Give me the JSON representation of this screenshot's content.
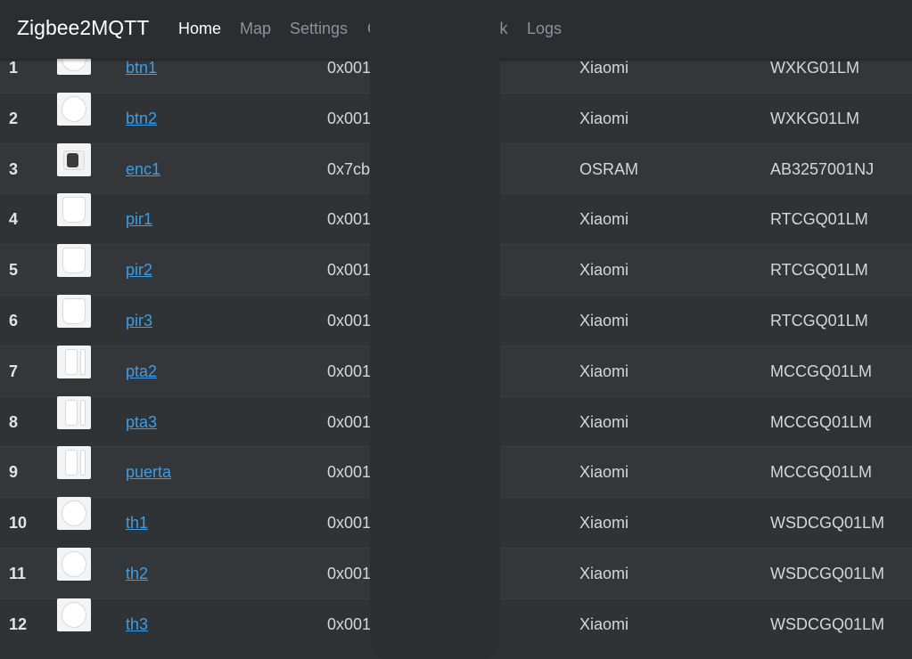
{
  "navbar": {
    "brand": "Zigbee2MQTT",
    "items": [
      {
        "label": "Home",
        "active": true
      },
      {
        "label": "Map",
        "active": false
      },
      {
        "label": "Settings",
        "active": false
      },
      {
        "label": "G",
        "active": false
      },
      {
        "label": "'ink",
        "active": false
      },
      {
        "label": "Logs",
        "active": false
      }
    ]
  },
  "devices": [
    {
      "num": "1",
      "name": "btn1",
      "addr": "0x001",
      "vendor": "Xiaomi",
      "model": "WXKG01LM",
      "icon": "round-button"
    },
    {
      "num": "2",
      "name": "btn2",
      "addr": "0x001",
      "vendor": "Xiaomi",
      "model": "WXKG01LM",
      "icon": "round-button"
    },
    {
      "num": "3",
      "name": "enc1",
      "addr": "0x7cb",
      "vendor": "OSRAM",
      "model": "AB3257001NJ",
      "icon": "plug"
    },
    {
      "num": "4",
      "name": "pir1",
      "addr": "0x001",
      "vendor": "Xiaomi",
      "model": "RTCGQ01LM",
      "icon": "motion-sensor"
    },
    {
      "num": "5",
      "name": "pir2",
      "addr": "0x001",
      "vendor": "Xiaomi",
      "model": "RTCGQ01LM",
      "icon": "motion-sensor"
    },
    {
      "num": "6",
      "name": "pir3",
      "addr": "0x001",
      "vendor": "Xiaomi",
      "model": "RTCGQ01LM",
      "icon": "motion-sensor"
    },
    {
      "num": "7",
      "name": "pta2",
      "addr": "0x001",
      "vendor": "Xiaomi",
      "model": "MCCGQ01LM",
      "icon": "door-sensor"
    },
    {
      "num": "8",
      "name": "pta3",
      "addr": "0x001",
      "vendor": "Xiaomi",
      "model": "MCCGQ01LM",
      "icon": "door-sensor"
    },
    {
      "num": "9",
      "name": "puerta",
      "addr": "0x001",
      "vendor": "Xiaomi",
      "model": "MCCGQ01LM",
      "icon": "door-sensor"
    },
    {
      "num": "10",
      "name": "th1",
      "addr": "0x001",
      "vendor": "Xiaomi",
      "model": "WSDCGQ01LM",
      "icon": "temp-sensor"
    },
    {
      "num": "11",
      "name": "th2",
      "addr": "0x001",
      "vendor": "Xiaomi",
      "model": "WSDCGQ01LM",
      "icon": "temp-sensor"
    },
    {
      "num": "12",
      "name": "th3",
      "addr": "0x001",
      "vendor": "Xiaomi",
      "model": "WSDCGQ01LM",
      "icon": "temp-sensor"
    }
  ],
  "colors": {
    "navbar_bg": "#2b2e30",
    "page_bg": "#303335",
    "link": "#3a9ee8",
    "nav_active": "#ffffff",
    "nav_inactive": "#8d9297"
  }
}
